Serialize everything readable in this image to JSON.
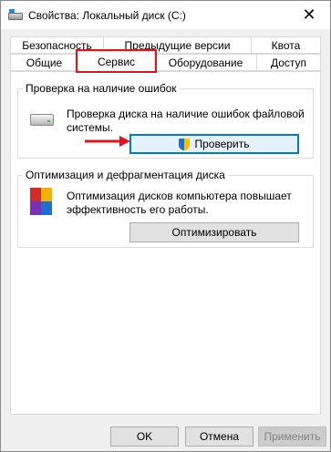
{
  "window": {
    "title": "Свойства: Локальный диск (C:)",
    "close_glyph": "✕"
  },
  "tabs_row1": [
    "Безопасность",
    "Предыдущие версии",
    "Квота"
  ],
  "tabs_row2": [
    "Общие",
    "Сервис",
    "Оборудование",
    "Доступ"
  ],
  "active_tab": "Сервис",
  "check_group": {
    "title": "Проверка на наличие ошибок",
    "description_line1": "Проверка диска на наличие ошибок файловой",
    "description_line2": "системы.",
    "button_label": "Проверить"
  },
  "optimize_group": {
    "title": "Оптимизация и дефрагментация диска",
    "description_line1": "Оптимизация дисков компьютера повышает",
    "description_line2": "эффективность его работы.",
    "button_label": "Оптимизировать"
  },
  "footer": {
    "ok_label": "OK",
    "cancel_label": "Отмена",
    "apply_label": "Применить"
  },
  "colors": {
    "highlight": "#e0141e",
    "focus": "#0078d7"
  }
}
